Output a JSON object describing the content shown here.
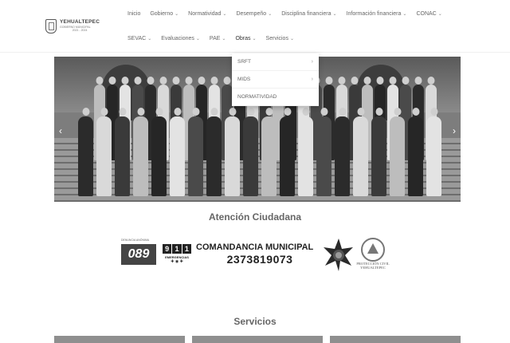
{
  "logo": {
    "name": "YEHUALTEPEC",
    "subtitle": "GOBIERNO MUNICIPAL",
    "years": "2021 - 2024"
  },
  "nav": {
    "row1": [
      {
        "label": "Inicio",
        "chevron": false
      },
      {
        "label": "Gobierno",
        "chevron": true
      },
      {
        "label": "Normatividad",
        "chevron": true
      },
      {
        "label": "Desempeño",
        "chevron": true
      },
      {
        "label": "Disciplina financiera",
        "chevron": true
      },
      {
        "label": "Información financiera",
        "chevron": true
      },
      {
        "label": "CONAC",
        "chevron": true
      }
    ],
    "row2": [
      {
        "label": "SEVAC",
        "chevron": true
      },
      {
        "label": "Evaluaciones",
        "chevron": true
      },
      {
        "label": "PAE",
        "chevron": true
      },
      {
        "label": "Obras",
        "chevron": true
      },
      {
        "label": "Servicios",
        "chevron": true
      }
    ]
  },
  "dropdown": {
    "items": [
      {
        "label": "SRFT",
        "submenu": true
      },
      {
        "label": "MIDS",
        "submenu": true
      },
      {
        "label": "NORMATIVIDAD",
        "submenu": false
      }
    ]
  },
  "slider": {
    "prev_icon": "chevron-left-icon",
    "next_icon": "chevron-right-icon"
  },
  "atencion": {
    "title": "Atención Ciudadana",
    "denuncia_label": "DENUNCIA ANÓNIMA",
    "denuncia_number": "089",
    "emergency_number": [
      "9",
      "1",
      "1"
    ],
    "emergency_label": "EMERGENCIAS",
    "commandery_title": "COMANDANCIA MUNICIPAL",
    "commandery_phone": "2373819073",
    "civil_protection": [
      "PROTECCIÓN CIVIL",
      "YEHUALTEPEC"
    ]
  },
  "servicios": {
    "title": "Servicios"
  }
}
